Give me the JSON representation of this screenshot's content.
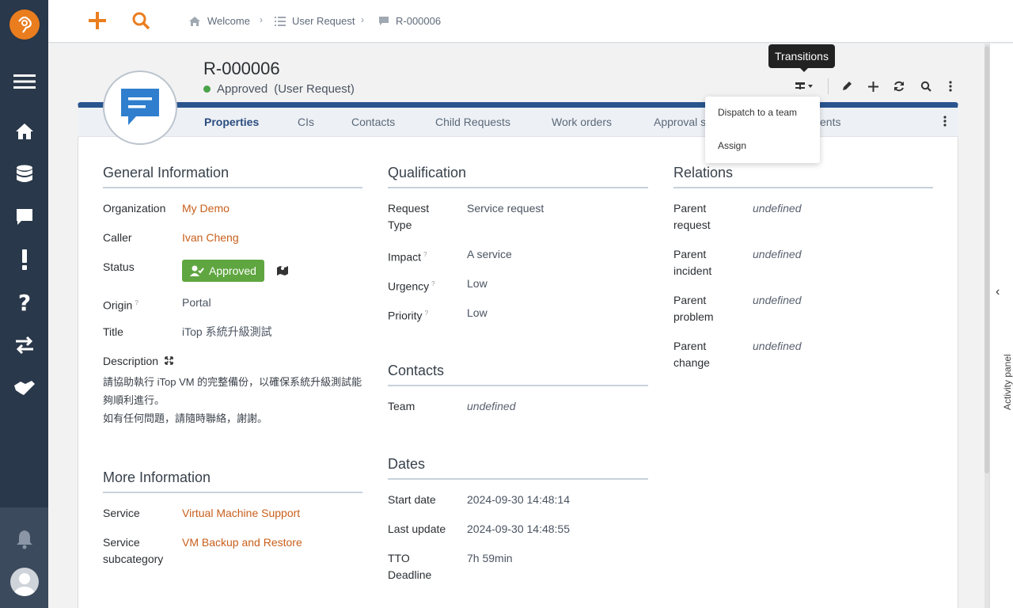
{
  "topbar": {
    "breadcrumbs": [
      {
        "label": "Welcome",
        "icon": "home-icon"
      },
      {
        "label": "User Request",
        "icon": "list-icon"
      },
      {
        "label": "R-000006",
        "icon": "request-icon"
      }
    ]
  },
  "sidebar": {
    "items": [
      {
        "name": "menu-icon"
      },
      {
        "name": "home-icon"
      },
      {
        "name": "database-icon"
      },
      {
        "name": "chat-icon"
      },
      {
        "name": "exclamation-icon"
      },
      {
        "name": "question-icon"
      },
      {
        "name": "transfer-icon"
      },
      {
        "name": "handshake-icon"
      }
    ]
  },
  "object": {
    "title": "R-000006",
    "status": "Approved",
    "status_class": "(User Request)"
  },
  "toolbar": {
    "tooltip": "Transitions",
    "dropdown": [
      "Dispatch to a team",
      "Assign"
    ]
  },
  "tabs": [
    "Properties",
    "CIs",
    "Contacts",
    "Child Requests",
    "Work orders",
    "Approval s",
    "ents"
  ],
  "general": {
    "title": "General Information",
    "organization_label": "Organization",
    "organization": "My Demo",
    "caller_label": "Caller",
    "caller": "Ivan Cheng",
    "status_label": "Status",
    "status": "Approved",
    "origin_label": "Origin",
    "origin": "Portal",
    "title_label": "Title",
    "title_value": "iTop 系統升級測試",
    "description_label": "Description",
    "description_line1": "請協助執行 iTop VM 的完整備份，以確保系統升級測試能夠順利進行。",
    "description_line2": "如有任何問題，請隨時聯絡，謝謝。"
  },
  "more": {
    "title": "More Information",
    "service_label": "Service",
    "service": "Virtual Machine Support",
    "subcat_label_1": "Service",
    "subcat_label_2": "subcategory",
    "subcat": "VM Backup and Restore"
  },
  "qualification": {
    "title": "Qualification",
    "type_label_1": "Request",
    "type_label_2": "Type",
    "type": "Service request",
    "impact_label": "Impact",
    "impact": "A service",
    "urgency_label": "Urgency",
    "urgency": "Low",
    "priority_label": "Priority",
    "priority": "Low"
  },
  "contacts": {
    "title": "Contacts",
    "team_label": "Team",
    "team": "undefined"
  },
  "dates": {
    "title": "Dates",
    "start_label": "Start date",
    "start": "2024-09-30 14:48:14",
    "update_label": "Last update",
    "update": "2024-09-30 14:48:55",
    "tto_label_1": "TTO",
    "tto_label_2": "Deadline",
    "tto": "7h 59min"
  },
  "relations": {
    "title": "Relations",
    "rows": [
      {
        "l1": "Parent",
        "l2": "request",
        "v": "undefined"
      },
      {
        "l1": "Parent",
        "l2": "incident",
        "v": "undefined"
      },
      {
        "l1": "Parent",
        "l2": "problem",
        "v": "undefined"
      },
      {
        "l1": "Parent",
        "l2": "change",
        "v": "undefined"
      }
    ]
  },
  "activity_panel": "Activity panel",
  "help_mark": "?",
  "colors": {
    "accent": "#ea7d1e",
    "sidebar": "#29384a",
    "link": "#c95f1b",
    "status": "#5fa640",
    "card_top": "#29548e"
  }
}
